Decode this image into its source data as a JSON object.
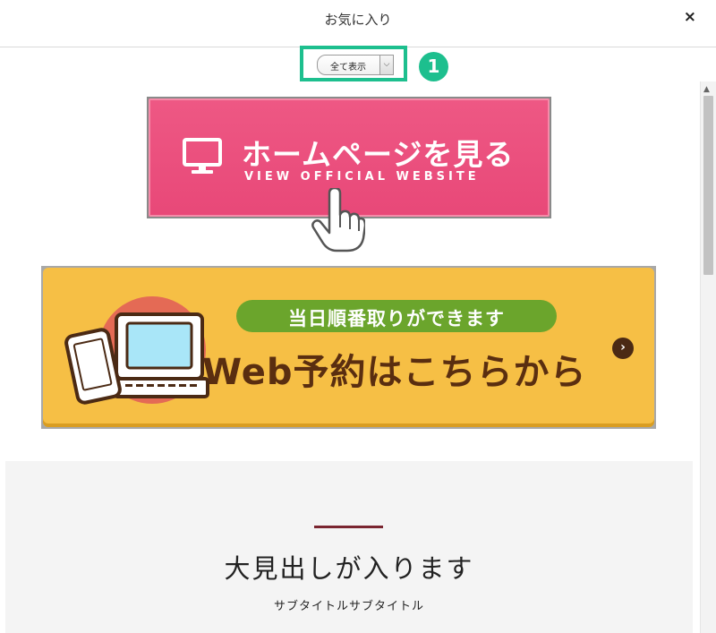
{
  "header": {
    "title": "お気に入り",
    "close_label": "×"
  },
  "select": {
    "selected": "全て表示",
    "arrow": "⌵"
  },
  "annotation": {
    "step": "1",
    "highlight_color": "#1dbf8e"
  },
  "scrollbar": {
    "up_arrow": "▲"
  },
  "homepage_banner": {
    "title": "ホームページを見る",
    "subtitle": "VIEW OFFICIAL WEBSITE",
    "icons": [
      "monitor-icon",
      "pointing-hand-icon"
    ],
    "color": "#e84878"
  },
  "web_booking_banner": {
    "pill_text": "当日順番取りができます",
    "title": "Web予約はこちらから",
    "arrow": "›",
    "color": "#f6bf45",
    "pill_color": "#6ba52c"
  },
  "section": {
    "heading": "大見出しが入ります",
    "subtitle": "サブタイトルサブタイトル",
    "accent_color": "#7a2530"
  }
}
